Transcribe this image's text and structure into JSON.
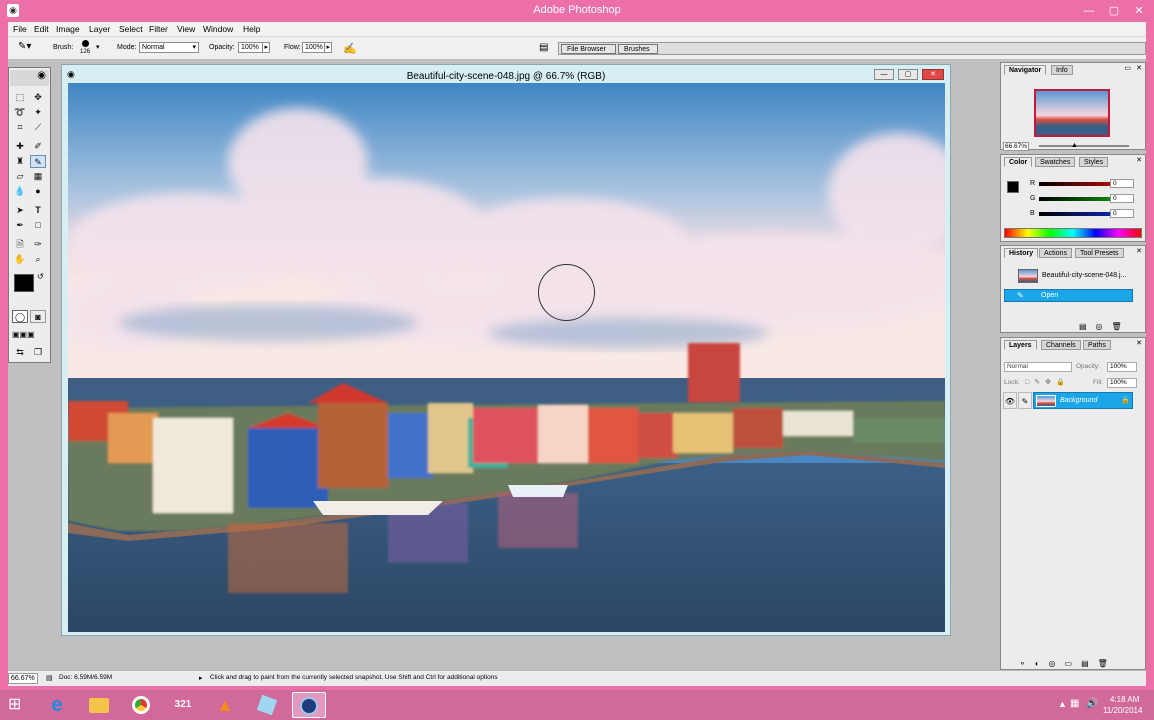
{
  "app": {
    "title": "Adobe Photoshop",
    "window_controls": {
      "minimize": "—",
      "maximize": "▢",
      "close": "✕"
    }
  },
  "menu": [
    "File",
    "Edit",
    "Image",
    "Layer",
    "Select",
    "Filter",
    "View",
    "Window",
    "Help"
  ],
  "options": {
    "brush_label": "Brush:",
    "brush_size": "126",
    "mode_label": "Mode:",
    "mode_value": "Normal",
    "opacity_label": "Opacity:",
    "opacity_value": "100%",
    "flow_label": "Flow:",
    "flow_value": "100%",
    "tabs": [
      "File Browser",
      "Brushes"
    ]
  },
  "document": {
    "title": "Beautiful-city-scene-048.jpg @ 66.7% (RGB)"
  },
  "navigator": {
    "tabs": [
      "Navigator",
      "Info"
    ],
    "zoom": "66.67%"
  },
  "color_panel": {
    "tabs": [
      "Color",
      "Swatches",
      "Styles"
    ],
    "channels": [
      {
        "label": "R",
        "value": "0",
        "color": "#e01010"
      },
      {
        "label": "G",
        "value": "0",
        "color": "#10b010"
      },
      {
        "label": "B",
        "value": "0",
        "color": "#1030e0"
      }
    ]
  },
  "history": {
    "tabs": [
      "History",
      "Actions",
      "Tool Presets"
    ],
    "snapshot": "Beautiful-city-scene-048.j...",
    "items": [
      "Open"
    ]
  },
  "layers": {
    "tabs": [
      "Layers",
      "Channels",
      "Paths"
    ],
    "blend_mode": "Normal",
    "opacity_label": "Opacity:",
    "opacity_value": "100%",
    "lock_label": "Lock:",
    "fill_label": "Fill:",
    "fill_value": "100%",
    "layer_name": "Background"
  },
  "status": {
    "zoom": "66.67%",
    "doc": "Doc: 6.59M/6.59M",
    "hint": "Click and drag to paint from the currently selected snapshot.  Use Shift and Ctrl for additional options"
  },
  "taskbar": {
    "time": "4:18 AM",
    "date": "11/20/2014"
  },
  "colors": {
    "window_frame": "#ec6fa8",
    "selection": "#1aa6e8"
  }
}
